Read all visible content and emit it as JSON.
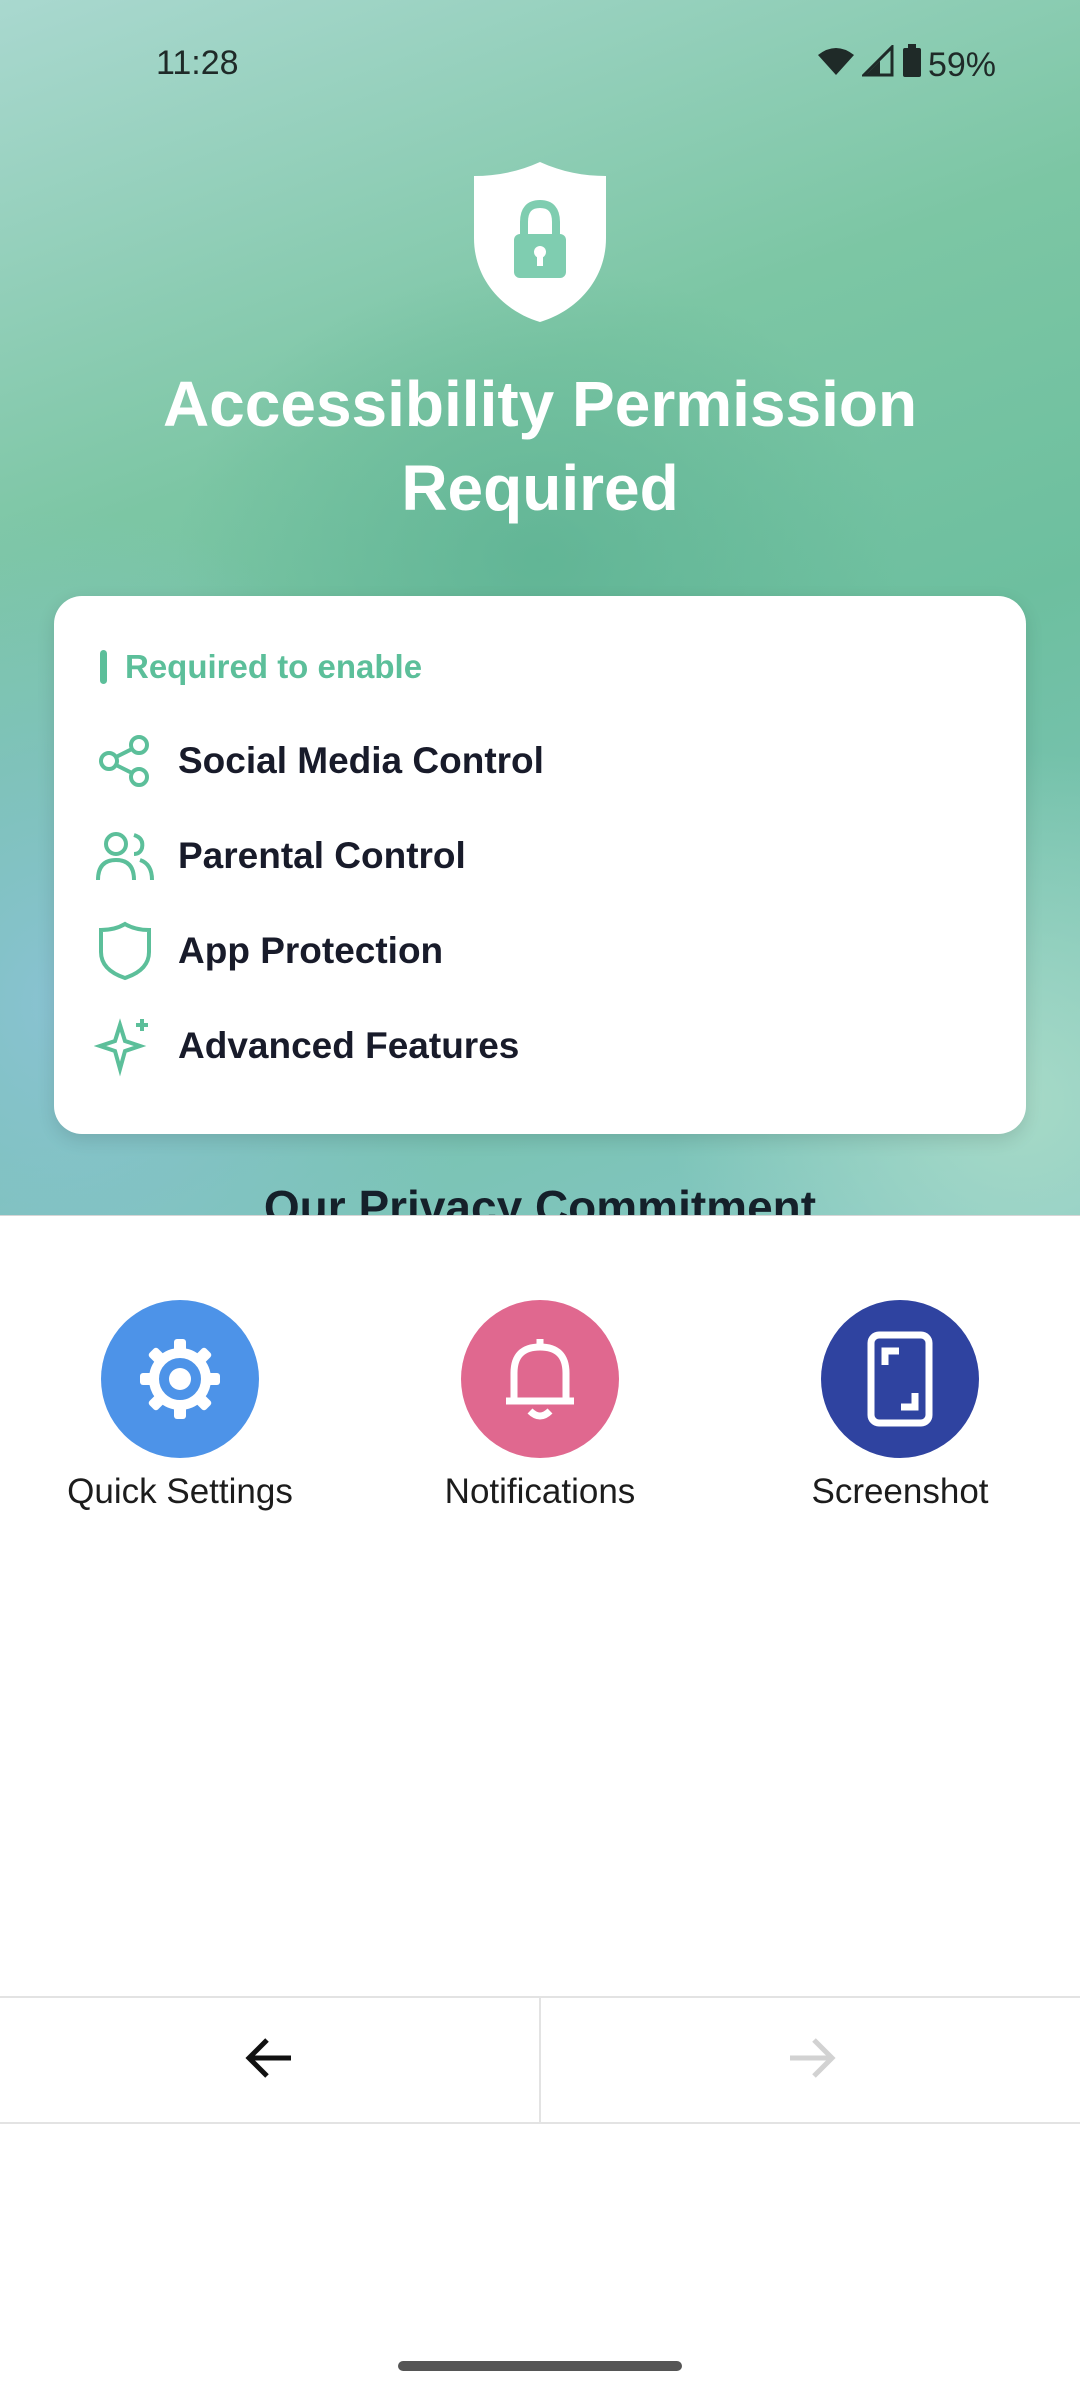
{
  "status_bar": {
    "time": "11:28",
    "battery": "59%",
    "icons": [
      "wifi-icon",
      "signal-icon",
      "battery-icon"
    ]
  },
  "hero": {
    "icon": "shield-lock-icon",
    "title": "Accessibility Permission Required",
    "title_line1": "Accessibility Permission",
    "title_line2": "Required"
  },
  "card": {
    "header": "Required to enable",
    "features": [
      {
        "icon": "share-icon",
        "label": "Social Media Control"
      },
      {
        "icon": "users-icon",
        "label": "Parental Control"
      },
      {
        "icon": "shield-icon",
        "label": "App Protection"
      },
      {
        "icon": "sparkles-icon",
        "label": "Advanced Features"
      }
    ]
  },
  "peek_text": "Our Privacy Commitment",
  "sheet": {
    "actions": [
      {
        "icon": "gear-icon",
        "label": "Quick Settings",
        "color": "#4d93e8"
      },
      {
        "icon": "bell-icon",
        "label": "Notifications",
        "color": "#e0688f"
      },
      {
        "icon": "screenshot-icon",
        "label": "Screenshot",
        "color": "#2f43a0"
      }
    ]
  },
  "nav": {
    "back_icon": "arrow-left-icon",
    "forward_icon": "arrow-right-icon"
  },
  "colors": {
    "accent": "#5cbf9a",
    "text_dark": "#181b2a"
  }
}
